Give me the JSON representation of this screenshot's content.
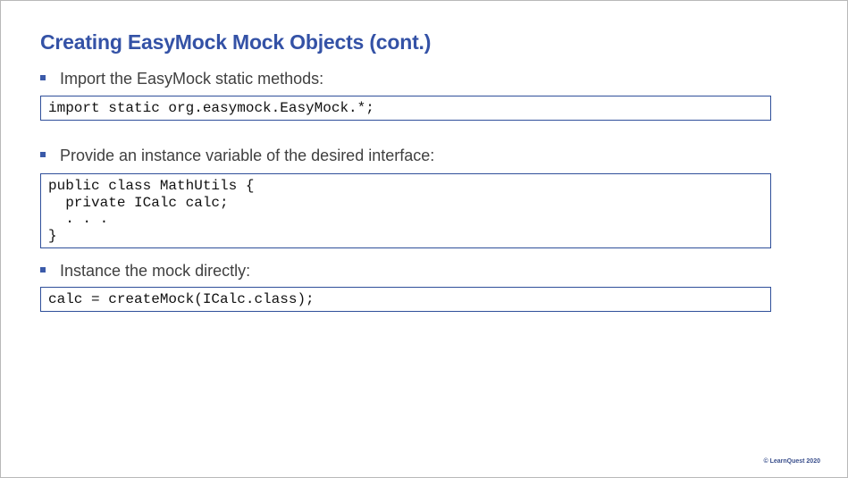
{
  "slide": {
    "title": "Creating EasyMock Mock Objects (cont.)",
    "bullets": [
      {
        "text": "Import the EasyMock static methods:",
        "code_lines": [
          "import static org.easymock.EasyMock.*;"
        ]
      },
      {
        "text": "Provide an instance variable of the desired interface:",
        "code_lines": [
          "public class MathUtils {",
          "  private ICalc calc;",
          "  . . .",
          "}"
        ]
      },
      {
        "text": "Instance the mock directly:",
        "code_lines": [
          "calc = createMock(ICalc.class);"
        ]
      }
    ],
    "footer": "© LearnQuest 2020"
  },
  "colors": {
    "title": "#3452a6",
    "bullet_marker": "#3b5aa9",
    "code_border": "#2f4f9a",
    "body_text": "#404040"
  }
}
